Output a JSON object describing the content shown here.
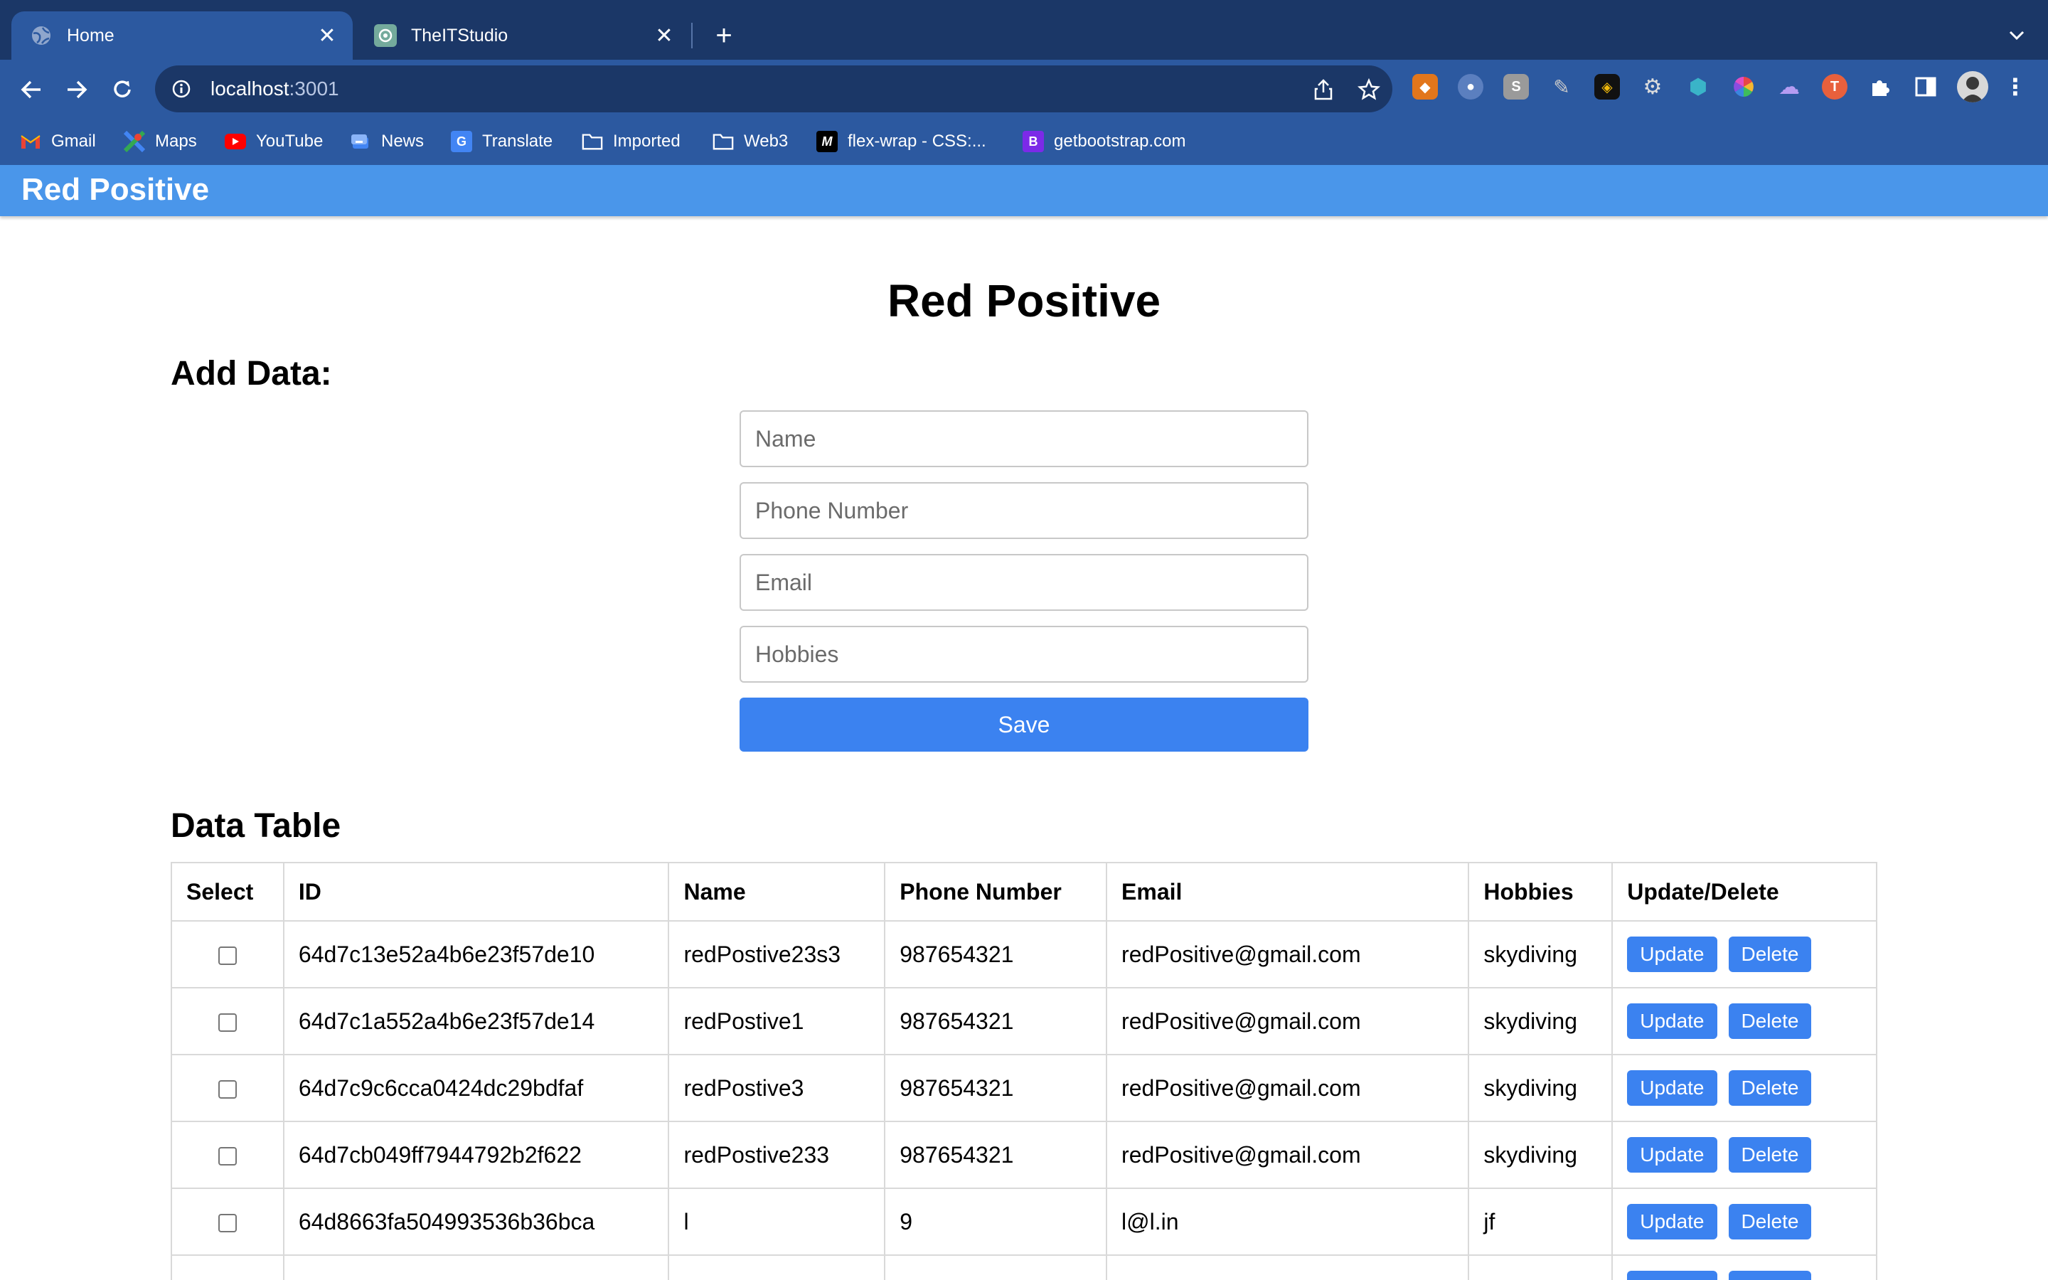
{
  "browser": {
    "tabs": [
      {
        "title": "Home",
        "active": true,
        "icon": "globe-icon"
      },
      {
        "title": "TheITStudio",
        "active": false,
        "icon": "openai-icon"
      }
    ],
    "url_host": "localhost",
    "url_port": ":3001",
    "bookmarks": [
      {
        "label": "Gmail",
        "icon": "gmail-icon"
      },
      {
        "label": "Maps",
        "icon": "maps-icon"
      },
      {
        "label": "YouTube",
        "icon": "youtube-icon"
      },
      {
        "label": "News",
        "icon": "news-icon"
      },
      {
        "label": "Translate",
        "icon": "translate-icon"
      },
      {
        "label": "Imported",
        "icon": "folder-icon"
      },
      {
        "label": "Web3",
        "icon": "folder-icon"
      },
      {
        "label": "flex-wrap - CSS:...",
        "icon": "mdn-icon",
        "glyph": "M"
      },
      {
        "label": "getbootstrap.com",
        "icon": "bootstrap-icon",
        "glyph": "B"
      }
    ],
    "colors": {
      "tabstrip": "#1b3767",
      "toolbar": "#2c59a0",
      "appbar": "#4a96ea",
      "accent": "#3b82f0"
    }
  },
  "app": {
    "brand": "Red Positive",
    "heading": "Red Positive",
    "add_section": "Add Data:",
    "form": {
      "name_placeholder": "Name",
      "phone_placeholder": "Phone Number",
      "email_placeholder": "Email",
      "hobbies_placeholder": "Hobbies",
      "save_label": "Save"
    },
    "table_section": "Data Table",
    "table": {
      "headers": [
        "Select",
        "ID",
        "Name",
        "Phone Number",
        "Email",
        "Hobbies",
        "Update/Delete"
      ],
      "update_label": "Update",
      "delete_label": "Delete",
      "rows": [
        {
          "id": "64d7c13e52a4b6e23f57de10",
          "name": "redPostive23s3",
          "phone": "987654321",
          "email": "redPositive@gmail.com",
          "hobbies": "skydiving"
        },
        {
          "id": "64d7c1a552a4b6e23f57de14",
          "name": "redPostive1",
          "phone": "987654321",
          "email": "redPositive@gmail.com",
          "hobbies": "skydiving"
        },
        {
          "id": "64d7c9c6cca0424dc29bdfaf",
          "name": "redPostive3",
          "phone": "987654321",
          "email": "redPositive@gmail.com",
          "hobbies": "skydiving"
        },
        {
          "id": "64d7cb049ff7944792b2f622",
          "name": "redPostive233",
          "phone": "987654321",
          "email": "redPositive@gmail.com",
          "hobbies": "skydiving"
        },
        {
          "id": "64d8663fa504993536b36bca",
          "name": "l",
          "phone": "9",
          "email": "l@l.in",
          "hobbies": "jf"
        }
      ]
    }
  }
}
